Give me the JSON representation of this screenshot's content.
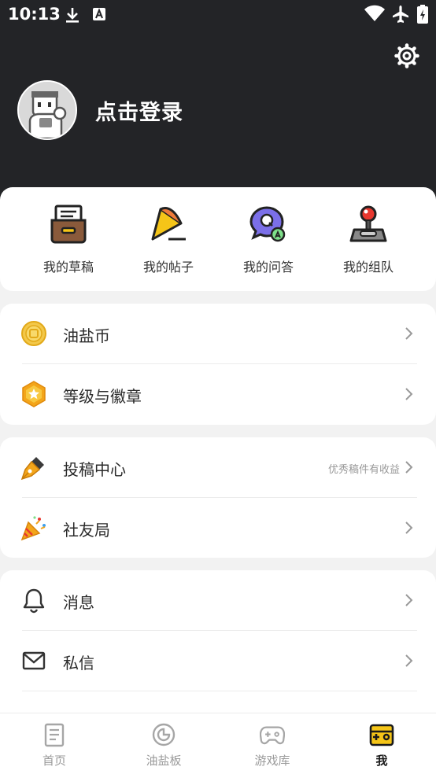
{
  "status_bar": {
    "time": "10:13",
    "icons": [
      "download-icon",
      "app-a-icon",
      "wifi-icon",
      "airplane-icon",
      "battery-charging-icon"
    ]
  },
  "header": {
    "login_text": "点击登录",
    "settings_icon": "gear-icon",
    "avatar_icon": "avatar-icon"
  },
  "quick_actions": [
    {
      "label": "我的草稿",
      "icon": "drafts-icon"
    },
    {
      "label": "我的帖子",
      "icon": "posts-icon"
    },
    {
      "label": "我的问答",
      "icon": "qa-icon"
    },
    {
      "label": "我的组队",
      "icon": "team-icon"
    }
  ],
  "groups": {
    "wallet": [
      {
        "label": "油盐币",
        "icon": "coin-icon"
      },
      {
        "label": "等级与徽章",
        "icon": "badge-icon"
      }
    ],
    "creator": [
      {
        "label": "投稿中心",
        "icon": "pen-icon",
        "hint": "优秀稿件有收益"
      },
      {
        "label": "社友局",
        "icon": "party-icon"
      }
    ],
    "messages": [
      {
        "label": "消息",
        "icon": "bell-icon"
      },
      {
        "label": "私信",
        "icon": "mail-icon"
      }
    ]
  },
  "bottom_nav": [
    {
      "label": "首页",
      "icon": "home-doc-icon",
      "active": false
    },
    {
      "label": "油盐板",
      "icon": "board-icon",
      "active": false
    },
    {
      "label": "游戏库",
      "icon": "gamepad-icon",
      "active": false
    },
    {
      "label": "我",
      "icon": "me-icon",
      "active": true
    }
  ],
  "colors": {
    "header_bg": "#232427",
    "accent_yellow": "#f5c518",
    "page_bg": "#f2f2f2"
  }
}
